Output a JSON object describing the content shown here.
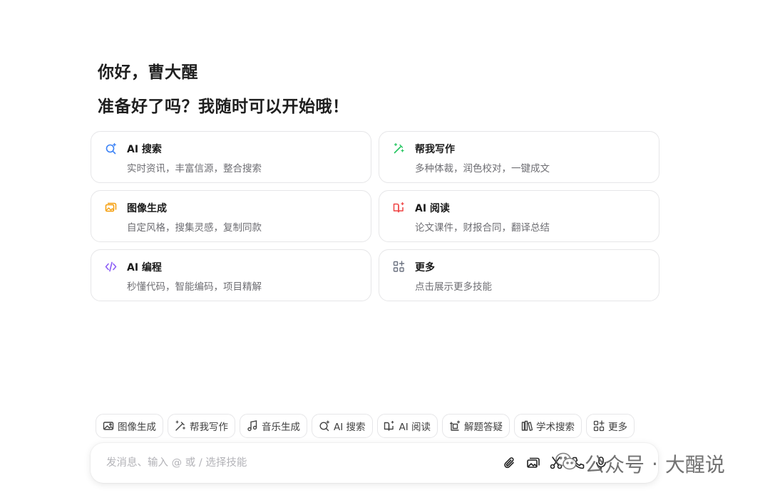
{
  "greeting": "你好，曹大醒",
  "subgreeting": "准备好了吗？我随时可以开始哦！",
  "cards": [
    {
      "icon": "ai-search-icon",
      "title": "AI 搜索",
      "desc": "实时资讯，丰富信源，整合搜索",
      "color": "#3b82f6"
    },
    {
      "icon": "writing-wand-icon",
      "title": "帮我写作",
      "desc": "多种体裁，润色校对，一键成文",
      "color": "#22c55e"
    },
    {
      "icon": "image-gen-icon",
      "title": "图像生成",
      "desc": "自定风格，搜集灵感，复制同款",
      "color": "#f59e0b"
    },
    {
      "icon": "ai-reading-icon",
      "title": "AI 阅读",
      "desc": "论文课件，财报合同，翻译总结",
      "color": "#ef4444"
    },
    {
      "icon": "code-icon",
      "title": "AI 编程",
      "desc": "秒懂代码，智能编码，项目精解",
      "color": "#8b5cf6"
    },
    {
      "icon": "more-apps-icon",
      "title": "更多",
      "desc": "点击展示更多技能",
      "color": "#6b7280"
    }
  ],
  "chips": [
    {
      "icon": "image-icon",
      "label": "图像生成"
    },
    {
      "icon": "writing-wand-icon",
      "label": "帮我写作"
    },
    {
      "icon": "music-icon",
      "label": "音乐生成"
    },
    {
      "icon": "ai-search-icon",
      "label": "AI 搜索"
    },
    {
      "icon": "ai-reading-icon",
      "label": "AI 阅读"
    },
    {
      "icon": "problem-solve-icon",
      "label": "解题答疑"
    },
    {
      "icon": "academic-icon",
      "label": "学术搜索"
    },
    {
      "icon": "more-apps-icon",
      "label": "更多"
    }
  ],
  "input": {
    "placeholder": "发消息、输入 @ 或 / 选择技能"
  },
  "tools": [
    "attach-icon",
    "image-upload-icon",
    "scissors-icon",
    "phone-icon",
    "microphone-icon"
  ],
  "watermark": {
    "left": "公众号",
    "dot": "·",
    "right": "大醒说"
  }
}
